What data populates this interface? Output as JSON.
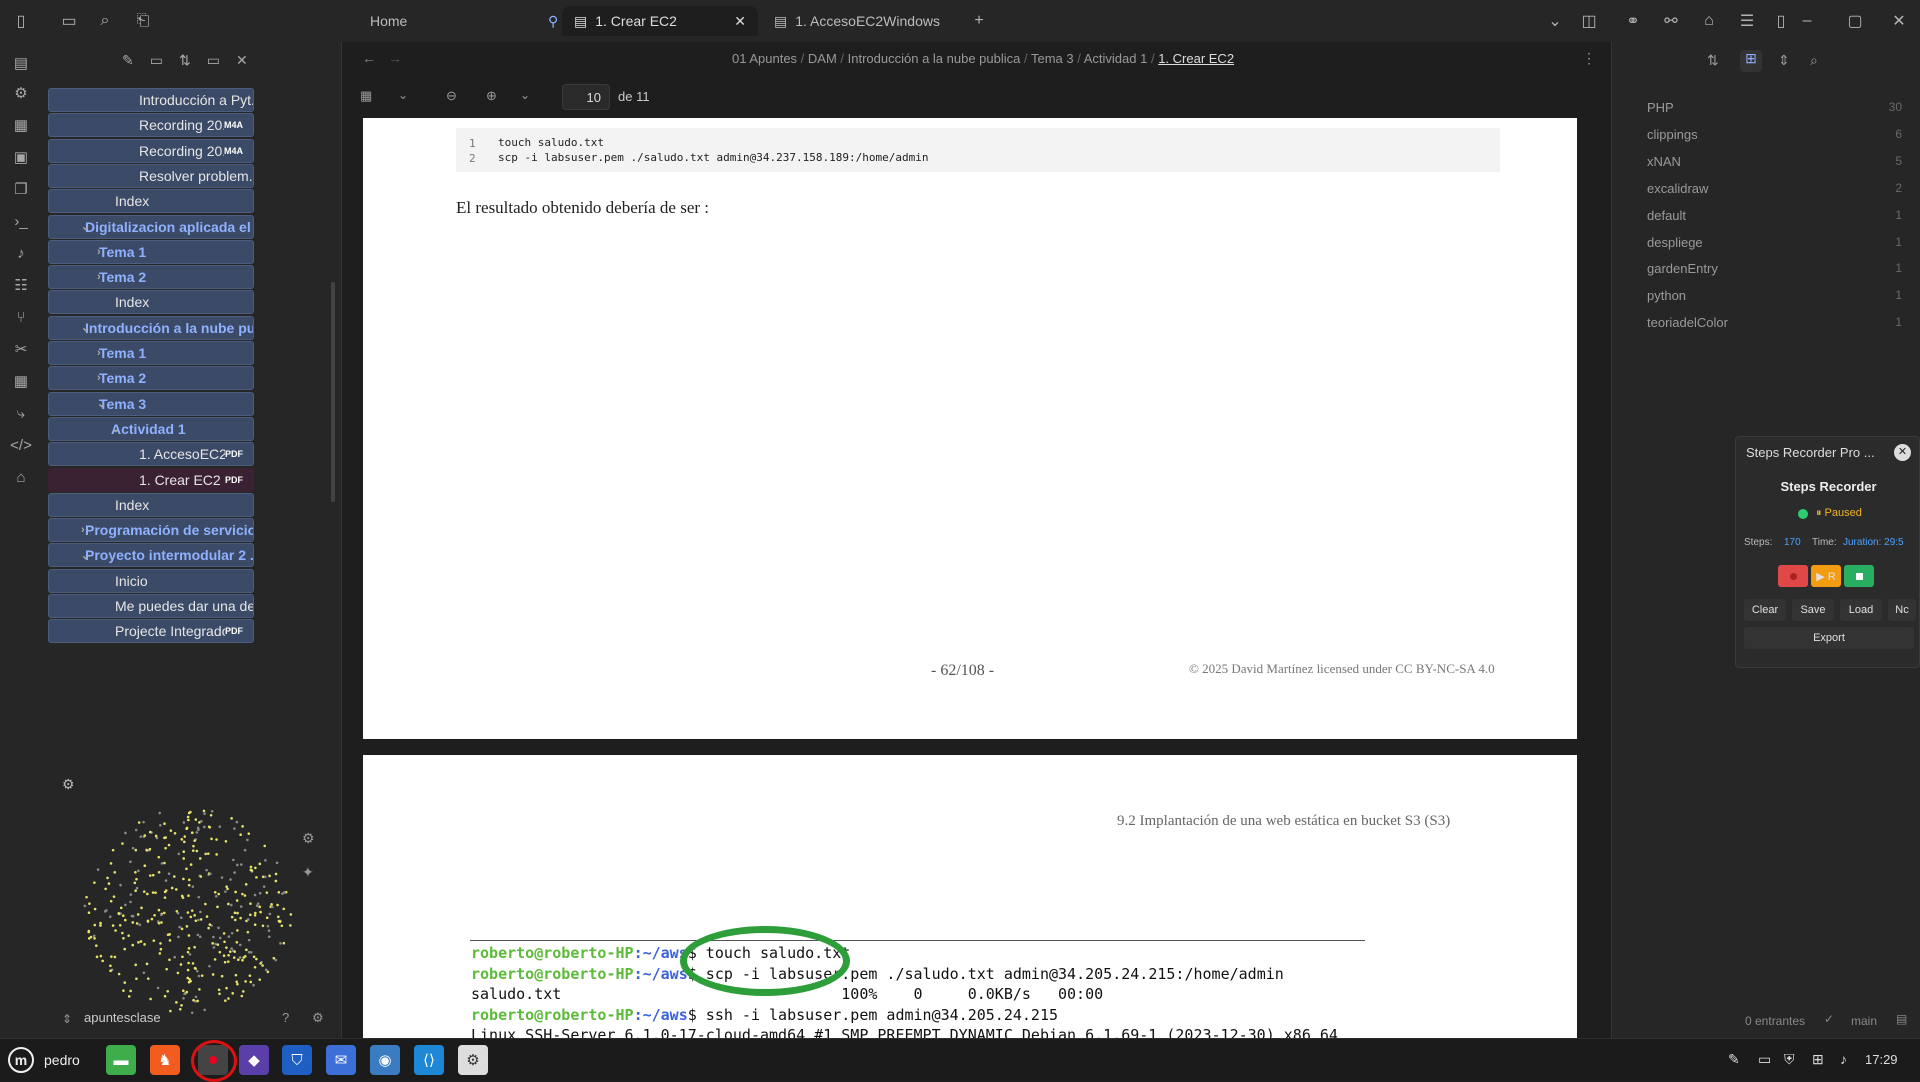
{
  "tabs": [
    {
      "label": "Home"
    },
    {
      "label": "1. Crear EC2"
    },
    {
      "label": "1. AccesoEC2Windows"
    }
  ],
  "breadcrumb": [
    "01 Apuntes",
    "DAM",
    "Introducción a la nube publica",
    "Tema 3",
    "Actividad 1",
    "1. Crear EC2"
  ],
  "pdf_toolbar": {
    "page": "10",
    "of": "de 11"
  },
  "explorer": [
    {
      "label": "Introducción a Pyt...",
      "level": 3,
      "folder": false,
      "badge": ""
    },
    {
      "label": "Recording 20...",
      "level": 3,
      "folder": false,
      "badge": "M4A"
    },
    {
      "label": "Recording 20...",
      "level": 3,
      "folder": false,
      "badge": "M4A"
    },
    {
      "label": "Resolver problem...",
      "level": 3,
      "folder": false,
      "badge": ""
    },
    {
      "label": "Index",
      "level": 2,
      "folder": false,
      "badge": ""
    },
    {
      "label": "Digitalizacion aplicada el ...",
      "level": 1,
      "folder": true,
      "open": true,
      "badge": ""
    },
    {
      "label": "Tema 1",
      "level": 2,
      "folder": true,
      "open": false,
      "badge": ""
    },
    {
      "label": "Tema 2",
      "level": 2,
      "folder": true,
      "open": false,
      "badge": ""
    },
    {
      "label": "Index",
      "level": 2,
      "folder": false,
      "badge": ""
    },
    {
      "label": "Introducción a la nube pu...",
      "level": 1,
      "folder": true,
      "open": true,
      "badge": ""
    },
    {
      "label": "Tema 1",
      "level": 2,
      "folder": true,
      "open": false,
      "badge": ""
    },
    {
      "label": "Tema 2",
      "level": 2,
      "folder": true,
      "open": false,
      "badge": ""
    },
    {
      "label": "Tema 3",
      "level": 2,
      "folder": true,
      "open": true,
      "badge": ""
    },
    {
      "label": "Actividad 1",
      "level": 3,
      "folder": true,
      "open": true,
      "badge": ""
    },
    {
      "label": "1. AccesoEC2...",
      "level": 4,
      "folder": false,
      "badge": "PDF"
    },
    {
      "label": "1. Crear EC2",
      "level": 4,
      "folder": false,
      "badge": "PDF",
      "active": true
    },
    {
      "label": "Index",
      "level": 2,
      "folder": false,
      "badge": ""
    },
    {
      "label": "Programación de servicio...",
      "level": 1,
      "folder": true,
      "open": false,
      "badge": ""
    },
    {
      "label": "Proyecto intermodular 2 ...",
      "level": 1,
      "folder": true,
      "open": true,
      "badge": ""
    },
    {
      "label": "Inicio",
      "level": 2,
      "folder": false,
      "badge": ""
    },
    {
      "label": "Me puedes dar una descri...",
      "level": 2,
      "folder": false,
      "badge": ""
    },
    {
      "label": "Projecte Integrador - ...",
      "level": 2,
      "folder": false,
      "badge": "PDF"
    }
  ],
  "vault": {
    "name": "apuntesclase"
  },
  "pdf": {
    "code_lines": [
      {
        "n": "1",
        "text": "touch saludo.txt"
      },
      {
        "n": "2",
        "text": "scp -i labsuser.pem ./saludo.txt admin@34.237.158.189:/home/admin"
      }
    ],
    "result_text": "El resultado obtenido debería de ser :",
    "page_number": "- 62/108 -",
    "license": "© 2025 David Martínez licensed under CC BY-NC-SA 4.0",
    "next_header": "9.2 Implantación de una web estática en bucket S3 (S3)",
    "terminal": [
      {
        "prompt": "roberto@roberto-HP",
        "path": ":~/aws",
        "cmd": "$ touch saludo.txt"
      },
      {
        "prompt": "roberto@roberto-HP",
        "path": ":~/aws",
        "cmd": "$ scp -i labsuser.pem ./saludo.txt admin@34.205.24.215:/home/admin"
      },
      {
        "prompt": "",
        "path": "",
        "cmd": "saludo.txt                               100%    0     0.0KB/s   00:00"
      },
      {
        "prompt": "roberto@roberto-HP",
        "path": ":~/aws",
        "cmd": "$ ssh -i labsuser.pem admin@34.205.24.215"
      },
      {
        "prompt": "",
        "path": "",
        "cmd": "Linux SSH-Server 6.1.0-17-cloud-amd64 #1 SMP PREEMPT_DYNAMIC Debian 6.1.69-1 (2023-12-30) x86_64"
      }
    ]
  },
  "tags": [
    {
      "name": "PHP",
      "count": "30"
    },
    {
      "name": "clippings",
      "count": "6"
    },
    {
      "name": "xNAN",
      "count": "5"
    },
    {
      "name": "excalidraw",
      "count": "2"
    },
    {
      "name": "default",
      "count": "1"
    },
    {
      "name": "despliege",
      "count": "1"
    },
    {
      "name": "gardenEntry",
      "count": "1"
    },
    {
      "name": "python",
      "count": "1"
    },
    {
      "name": "teoriadelColor",
      "count": "1"
    }
  ],
  "steps_recorder": {
    "window_title": "Steps Recorder Pro ...",
    "title": "Steps Recorder",
    "status": "⏸ Paused",
    "steps_label": "Steps:",
    "steps_value": "170",
    "time_label": "Time:",
    "duration": "Juration: 29:5",
    "resume_label": "▶ R",
    "buttons": [
      "Clear",
      "Save",
      "Load",
      "Nc"
    ],
    "export": "Export"
  },
  "status_bar": {
    "entries": "0 entrantes",
    "branch": "main"
  },
  "taskbar": {
    "user": "pedro",
    "clock": "17:29"
  },
  "colors": {
    "accent": "#8fb1ff",
    "green_circle": "#2e9e3a",
    "term_prompt": "#5dbb3a",
    "term_path": "#3b62d9"
  }
}
